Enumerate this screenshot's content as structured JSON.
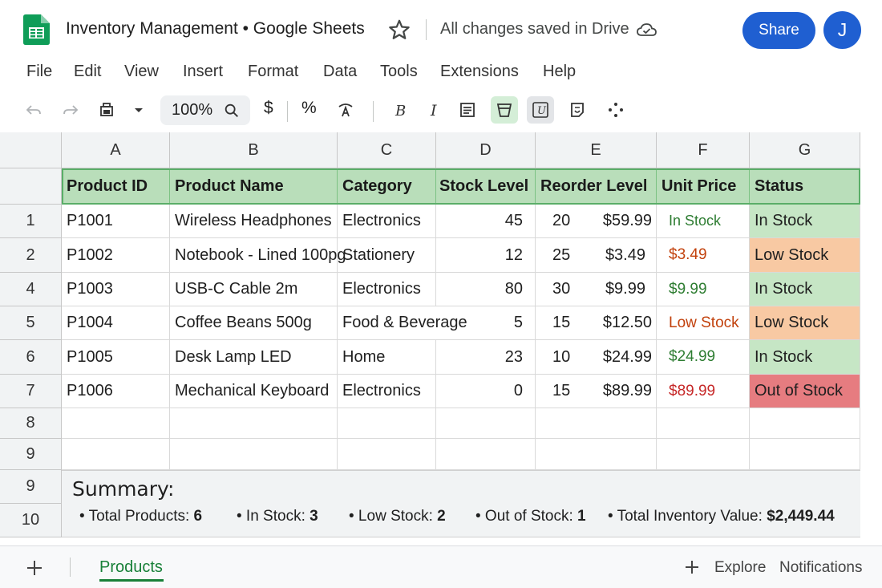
{
  "app": {
    "title": "Inventory Management • Google Sheets",
    "save_status": "All changes saved in Drive",
    "share_label": "Share",
    "avatar_initial": "J",
    "brand_color": "#1f5fd1"
  },
  "menu": [
    "File",
    "Edit",
    "View",
    "Insert",
    "Format",
    "Data",
    "Tools",
    "Extensions",
    "Help"
  ],
  "toolbar": {
    "zoom": "100%",
    "currency": "$",
    "percent": "%"
  },
  "columns": [
    "A",
    "B",
    "C",
    "D",
    "E",
    "F",
    "G"
  ],
  "header_row": [
    "Product ID",
    "Product Name",
    "Category",
    "Stock Level",
    "Reorder Level",
    "Unit Price",
    "Status"
  ],
  "row_numbers": [
    "1",
    "2",
    "4",
    "5",
    "6",
    "7",
    "8",
    "9",
    "9",
    "10"
  ],
  "rows": [
    {
      "id": "P1001",
      "name": "Wireless Headphones",
      "category": "Electronics",
      "stock": "45",
      "reorder": "20",
      "price": "$59.99",
      "f": "In Stock",
      "f_color": "green",
      "status": "In Stock",
      "status_type": "in"
    },
    {
      "id": "P1002",
      "name": "Notebook - Lined 100pg",
      "category": "Stationery",
      "stock": "12",
      "reorder": "25",
      "price": "$3.49",
      "f": "$3.49",
      "f_color": "orange",
      "status": "Low Stock",
      "status_type": "low"
    },
    {
      "id": "P1003",
      "name": "USB-C Cable 2m",
      "category": "Electronics",
      "stock": "80",
      "reorder": "30",
      "price": "$9.99",
      "f": "$9.99",
      "f_color": "green",
      "status": "In Stock",
      "status_type": "in"
    },
    {
      "id": "P1004",
      "name": "Coffee Beans 500g",
      "category": "Food & Beverage",
      "stock": "5",
      "reorder": "15",
      "price": "$12.50",
      "f": "Low Stock",
      "f_color": "orange",
      "status": "Low Stock",
      "status_type": "low"
    },
    {
      "id": "P1005",
      "name": "Desk Lamp LED",
      "category": "Home",
      "stock": "23",
      "reorder": "10",
      "price": "$24.99",
      "f": "$24.99",
      "f_color": "green",
      "status": "In Stock",
      "status_type": "in"
    },
    {
      "id": "P1006",
      "name": "Mechanical Keyboard",
      "category": "Electronics",
      "stock": "0",
      "reorder": "15",
      "price": "$89.99",
      "f": "$89.99",
      "f_color": "red",
      "status": "Out of Stock",
      "status_type": "out"
    }
  ],
  "summary": {
    "title": "Summary:",
    "total_products_label": "• Total Products: ",
    "total_products": "6",
    "in_stock_label": "• In Stock: ",
    "in_stock": "3",
    "low_stock_label": "• Low Stock: ",
    "low_stock": "2",
    "out_of_stock_label": "• Out of Stock: ",
    "out_of_stock": "1",
    "inventory_value_label": "• Total Inventory Value: ",
    "inventory_value": "$2,449.44"
  },
  "bottom": {
    "sheet_tab": "Products",
    "explore": "Explore",
    "notifications": "Notifications"
  },
  "colors": {
    "header_fill": "#b9deba",
    "in_stock_fill": "#c6e6c5",
    "low_stock_fill": "#f8c9a3",
    "out_of_stock_fill": "#e67c80",
    "sheet_green": "#188038"
  }
}
